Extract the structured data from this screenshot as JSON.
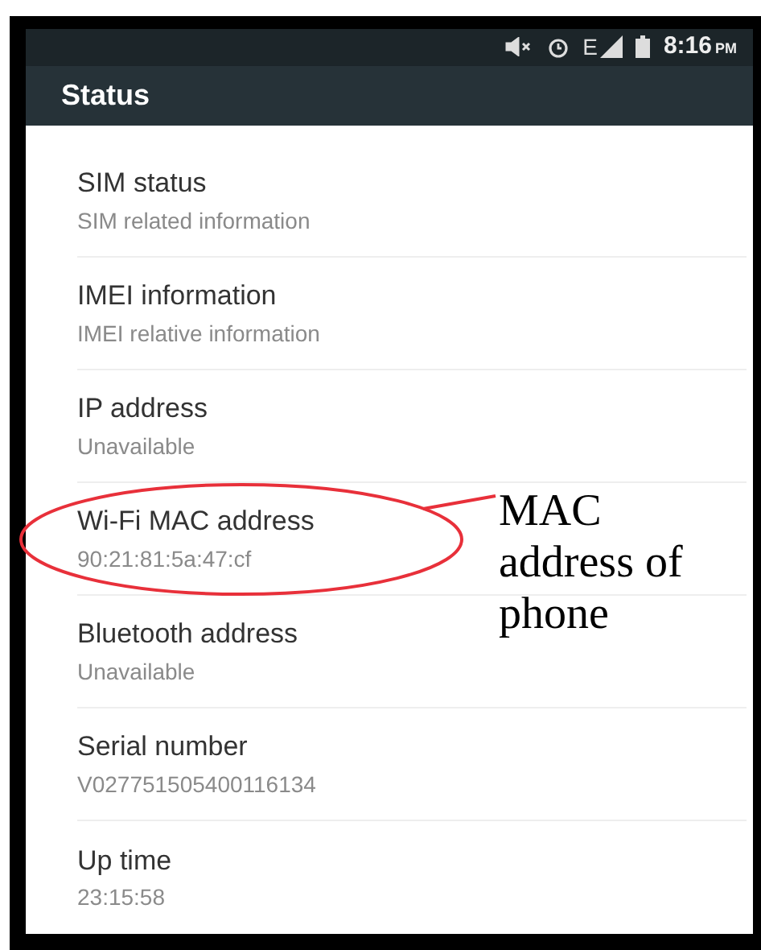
{
  "status_bar": {
    "network": "E",
    "time": "8:16",
    "ampm": "PM"
  },
  "toolbar": {
    "title": "Status"
  },
  "items": [
    {
      "title": "SIM status",
      "summary": "SIM related information",
      "circled": false
    },
    {
      "title": "IMEI information",
      "summary": "IMEI relative information",
      "circled": false
    },
    {
      "title": "IP address",
      "summary": "Unavailable",
      "circled": false
    },
    {
      "title": "Wi-Fi MAC address",
      "summary": "90:21:81:5a:47:cf",
      "circled": true
    },
    {
      "title": "Bluetooth address",
      "summary": "Unavailable",
      "circled": false
    },
    {
      "title": "Serial number",
      "summary": "V027751505400116134",
      "circled": false
    },
    {
      "title": "Up time",
      "summary": "23:15:58",
      "circled": false
    }
  ],
  "annotation": {
    "text": "MAC address of phone"
  }
}
